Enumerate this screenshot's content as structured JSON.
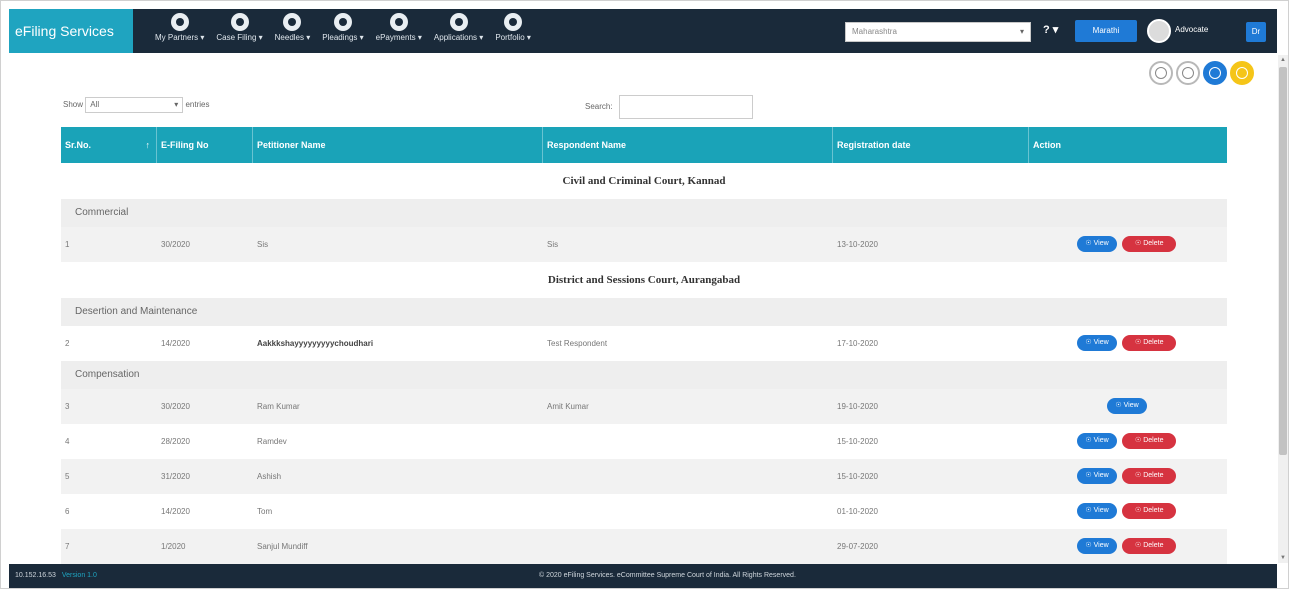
{
  "brand": "eFiling Services",
  "nav": [
    {
      "label": "My Partners",
      "icon": "partners-icon"
    },
    {
      "label": "Case Filing",
      "icon": "case-filing-icon"
    },
    {
      "label": "Needles",
      "icon": "needles-icon"
    },
    {
      "label": "Pleadings",
      "icon": "pleadings-icon"
    },
    {
      "label": "ePayments",
      "icon": "epayments-icon"
    },
    {
      "label": "Applications",
      "icon": "applications-icon"
    },
    {
      "label": "Portfolio",
      "icon": "portfolio-icon"
    }
  ],
  "header": {
    "state_select": "Maharashtra",
    "help": "?",
    "language": "Marathi",
    "username": "Advocate",
    "user_btn": "Dr"
  },
  "controls": {
    "show_label": "Show",
    "entries_value": "All",
    "entries_label": "entries",
    "search_label": "Search:"
  },
  "table": {
    "headers": [
      "Sr.No.",
      "E-Filing No",
      "Petitioner Name",
      "Respondent Name",
      "Registration date",
      "Action"
    ],
    "court1": "Civil and Criminal Court, Kannad",
    "group1": "Commercial",
    "court2": "District and Sessions Court, Aurangabad",
    "group2": "Desertion and Maintenance",
    "group3": "Compensation",
    "rows": [
      {
        "sr": "1",
        "efil": "30/2020",
        "pet": "Sis",
        "resp": "Sis",
        "date": "13-10-2020"
      },
      {
        "sr": "2",
        "efil": "14/2020",
        "pet": "Aakkkshayyyyyyyyychoudhari",
        "resp": "Test Respondent",
        "date": "17-10-2020"
      },
      {
        "sr": "3",
        "efil": "30/2020",
        "pet": "Ram Kumar",
        "resp": "Amit Kumar",
        "date": "19-10-2020"
      },
      {
        "sr": "4",
        "efil": "28/2020",
        "pet": "Ramdev",
        "resp": "",
        "date": "15-10-2020"
      },
      {
        "sr": "5",
        "efil": "31/2020",
        "pet": "Ashish",
        "resp": "",
        "date": "15-10-2020"
      },
      {
        "sr": "6",
        "efil": "14/2020",
        "pet": "Tom",
        "resp": "",
        "date": "01-10-2020"
      },
      {
        "sr": "7",
        "efil": "1/2020",
        "pet": "Sanjul Mundiff",
        "resp": "",
        "date": "29-07-2020"
      }
    ],
    "view_label": "View",
    "delete_label": "Delete"
  },
  "footer": {
    "ip": "10.152.16.53",
    "version": "Version 1.0",
    "copyright": "© 2020 eFiling Services. eCommittee Supreme Court of India. All Rights Reserved."
  },
  "colors": {
    "navbar": "#1a2a3a",
    "brand": "#1fa4c0",
    "table_header": "#1aa3b8",
    "view": "#1f7ad6",
    "delete": "#d63340"
  }
}
